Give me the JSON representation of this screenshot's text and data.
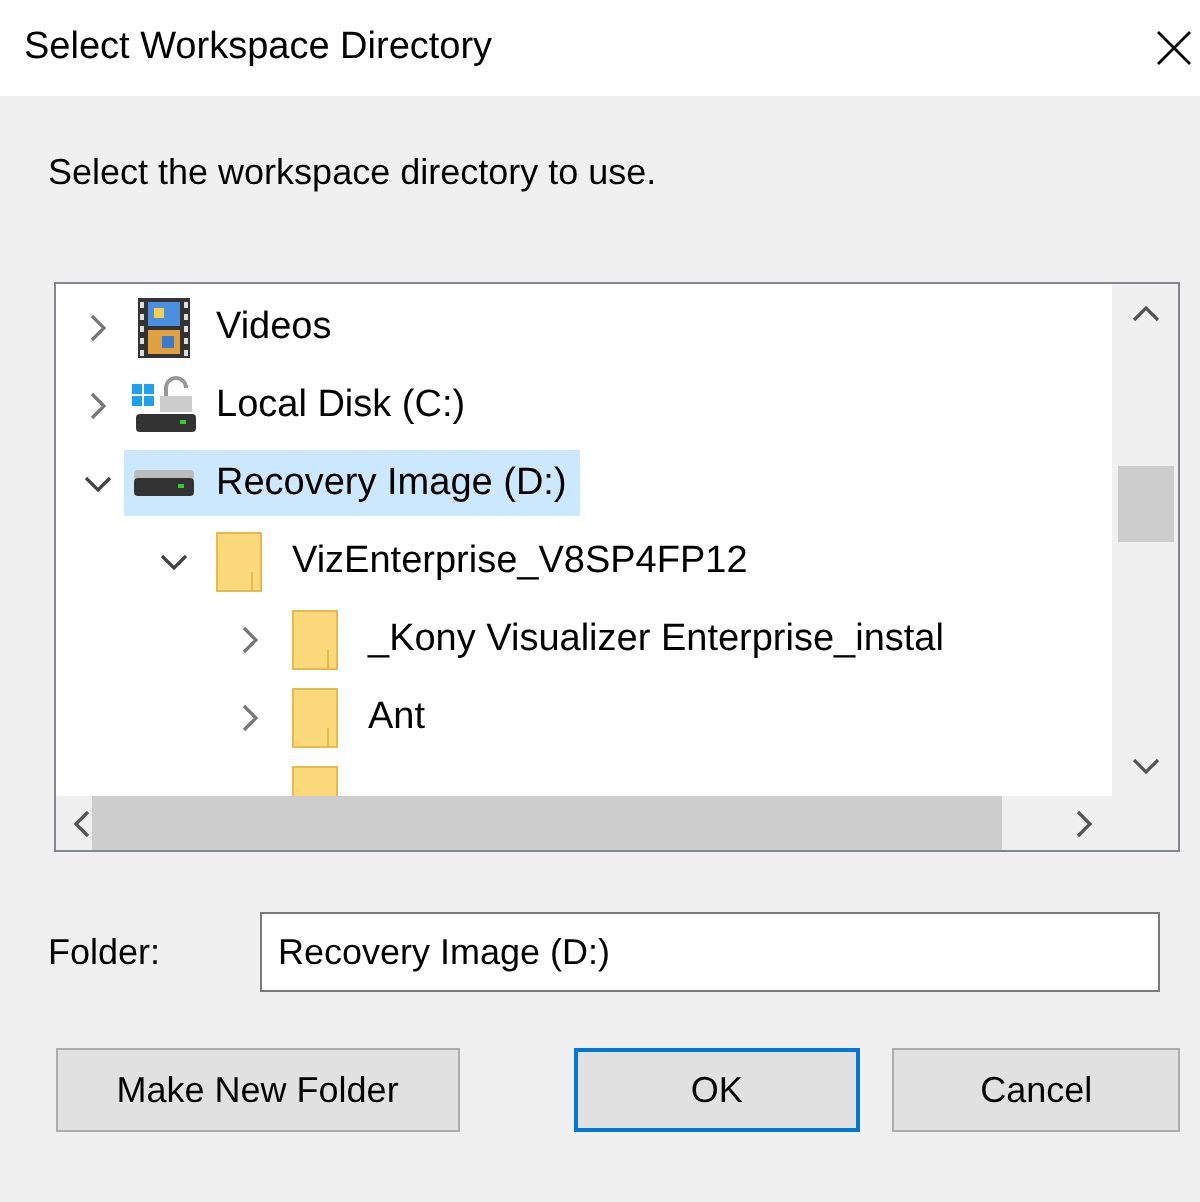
{
  "window": {
    "title": "Select Workspace Directory"
  },
  "prompt": "Select the workspace directory to use.",
  "tree": [
    {
      "label": "Videos",
      "kind": "videos",
      "expanded": false,
      "selected": false
    },
    {
      "label": "Local Disk (C:)",
      "kind": "system-disk",
      "expanded": false,
      "selected": false
    },
    {
      "label": "Recovery Image (D:)",
      "kind": "drive",
      "expanded": true,
      "selected": true,
      "children": [
        {
          "label": "VizEnterprise_V8SP4FP12",
          "kind": "folder",
          "expanded": true,
          "selected": false,
          "children": [
            {
              "label": "_Kony Visualizer Enterprise_instal",
              "kind": "folder",
              "expanded": false,
              "selected": false
            },
            {
              "label": "Ant",
              "kind": "folder",
              "expanded": false,
              "selected": false
            },
            {
              "kind": "folder",
              "selected": false
            }
          ]
        }
      ]
    }
  ],
  "folder": {
    "label": "Folder:",
    "value": "Recovery Image (D:)"
  },
  "buttons": [
    {
      "label": "Make New Folder",
      "default": false
    },
    {
      "label": "OK",
      "default": true
    },
    {
      "label": "Cancel",
      "default": false
    }
  ]
}
